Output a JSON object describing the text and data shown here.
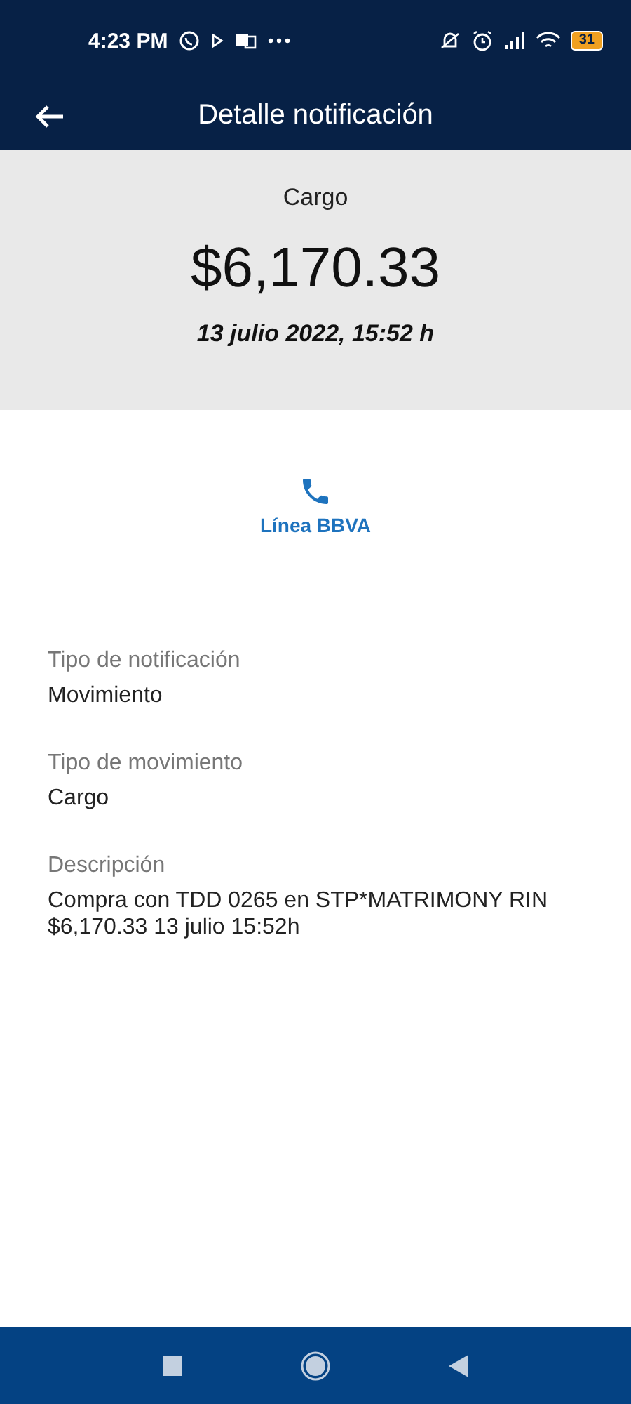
{
  "status_bar": {
    "time": "4:23 PM",
    "battery": "31"
  },
  "app_bar": {
    "title": "Detalle notificación"
  },
  "summary": {
    "type": "Cargo",
    "amount": "$6,170.33",
    "date": "13 julio 2022, 15:52 h"
  },
  "contact": {
    "label": "Línea BBVA"
  },
  "fields": [
    {
      "label": "Tipo de notificación",
      "value": "Movimiento"
    },
    {
      "label": "Tipo de movimiento",
      "value": "Cargo"
    },
    {
      "label": "Descripción",
      "value": "Compra con TDD 0265 en STP*MATRIMONY RIN $6,170.33 13 julio 15:52h"
    }
  ]
}
